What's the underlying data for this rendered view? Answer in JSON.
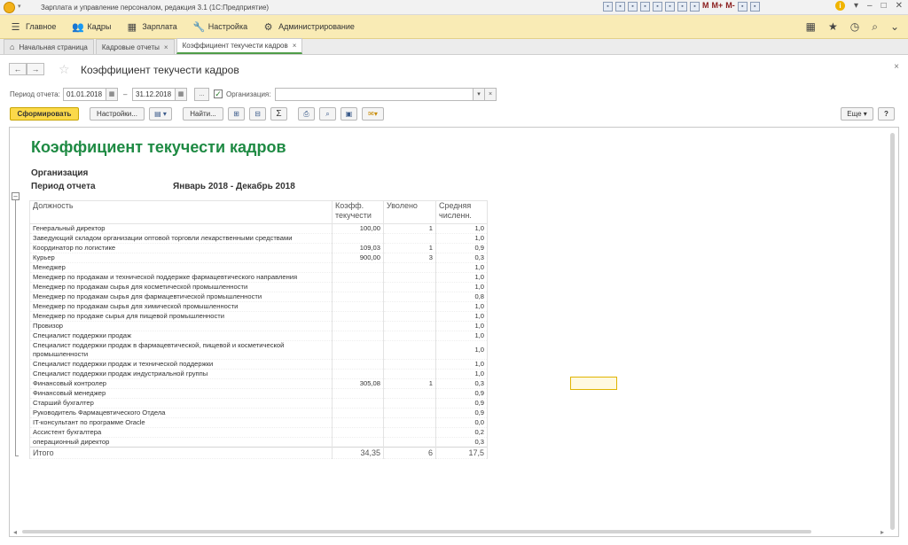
{
  "window": {
    "title": "Зарплата и управление персоналом, редакция 3.1  (1С:Предприятие)",
    "toolbar_letters": [
      "M",
      "M+",
      "M-"
    ]
  },
  "main_menu": {
    "items": [
      {
        "label": "Главное",
        "icon": "menu-icon"
      },
      {
        "label": "Кадры",
        "icon": "people-icon"
      },
      {
        "label": "Зарплата",
        "icon": "calculator-icon"
      },
      {
        "label": "Настройка",
        "icon": "wrench-icon"
      },
      {
        "label": "Администрирование",
        "icon": "gear-icon"
      }
    ]
  },
  "tabs": [
    {
      "label": "Начальная страница"
    },
    {
      "label": "Кадровые отчеты"
    },
    {
      "label": "Коэффициент текучести кадров"
    }
  ],
  "form": {
    "title": "Коэффициент текучести кадров",
    "period_label": "Период отчета:",
    "date_from": "01.01.2018",
    "date_sep": "–",
    "date_to": "31.12.2018",
    "ellipsis": "...",
    "org_label": "Организация:",
    "org_checked": true,
    "org_value": ""
  },
  "toolbar": {
    "generate": "Сформировать",
    "settings": "Настройки...",
    "find": "Найти...",
    "sum": "Σ",
    "more": "Еще",
    "help": "?"
  },
  "report": {
    "title": "Коэффициент текучести кадров",
    "org_label": "Организация",
    "period_label": "Период отчета",
    "period_value": "Январь 2018 - Декабрь 2018",
    "columns": [
      "Должность",
      "Коэфф. текучести",
      "Уволено",
      "Средняя численн."
    ],
    "rows": [
      [
        "Генеральный директор",
        "100,00",
        "1",
        "1,0"
      ],
      [
        "Заведующий складом организации оптовой торговли лекарственными средствами",
        "",
        "",
        "1,0"
      ],
      [
        "Координатор по логистике",
        "109,03",
        "1",
        "0,9"
      ],
      [
        "Курьер",
        "900,00",
        "3",
        "0,3"
      ],
      [
        "Менеджер",
        "",
        "",
        "1,0"
      ],
      [
        "Менеджер по продажам и технической поддержке фармацевтического направления",
        "",
        "",
        "1,0"
      ],
      [
        "Менеджер по продажам сырья для косметической промышленности",
        "",
        "",
        "1,0"
      ],
      [
        "Менеджер по продажам сырья для фармацевтической промышленности",
        "",
        "",
        "0,8"
      ],
      [
        "Менеджер по продажам сырья для химической промышленности",
        "",
        "",
        "1,0"
      ],
      [
        "Менеджер по продаже сырья для пищевой промышленности",
        "",
        "",
        "1,0"
      ],
      [
        "Провизор",
        "",
        "",
        "1,0"
      ],
      [
        "Специалист поддержки продаж",
        "",
        "",
        "1,0"
      ],
      [
        "Специалист поддержки продаж в фармацевтической, пищевой и косметической промышленности",
        "",
        "",
        "1,0"
      ],
      [
        "Специалист поддержки продаж и технической поддержки",
        "",
        "",
        "1,0"
      ],
      [
        "Специалист поддержки продаж индустриальной группы",
        "",
        "",
        "1,0"
      ],
      [
        "Финансовый контролер",
        "305,08",
        "1",
        "0,3"
      ],
      [
        "Финансовый менеджер",
        "",
        "",
        "0,9"
      ],
      [
        "Старший бухгалтер",
        "",
        "",
        "0,9"
      ],
      [
        "Руководитель Фармацевтического Отдела",
        "",
        "",
        "0,9"
      ],
      [
        "IT-консультант по программе Oracle",
        "",
        "",
        "0,0"
      ],
      [
        "Ассистент бухгалтера",
        "",
        "",
        "0,2"
      ],
      [
        "операционный директор",
        "",
        "",
        "0,3"
      ]
    ],
    "total": [
      "Итого",
      "34,35",
      "6",
      "17,5"
    ]
  }
}
